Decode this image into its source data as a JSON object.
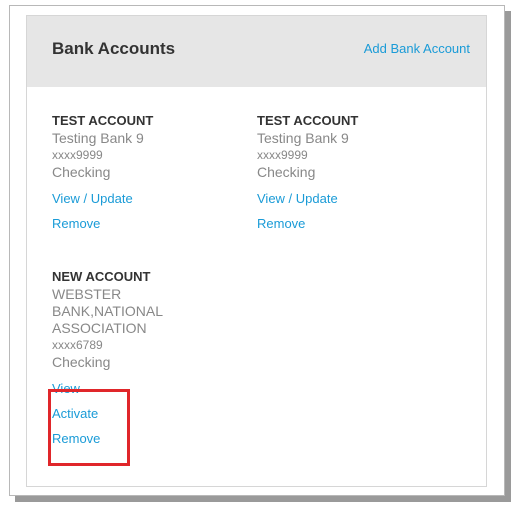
{
  "header": {
    "title": "Bank Accounts",
    "add_link": "Add Bank Account"
  },
  "accounts": [
    {
      "name": "TEST ACCOUNT",
      "bank_lines": [
        "Testing Bank 9"
      ],
      "mask": "xxxx9999",
      "type": "Checking",
      "links": [
        "View / Update",
        "Remove"
      ]
    },
    {
      "name": "TEST ACCOUNT",
      "bank_lines": [
        "Testing Bank 9"
      ],
      "mask": "xxxx9999",
      "type": "Checking",
      "links": [
        "View / Update",
        "Remove"
      ]
    },
    {
      "name": "NEW ACCOUNT",
      "bank_lines": [
        "WEBSTER",
        "BANK,NATIONAL",
        "ASSOCIATION"
      ],
      "mask": "xxxx6789",
      "type": "Checking",
      "links": [
        "View",
        "Activate",
        "Remove"
      ]
    }
  ],
  "colors": {
    "link": "#1a9bd7",
    "highlight": "#e0262a",
    "header_bg": "#e6e6e6"
  }
}
